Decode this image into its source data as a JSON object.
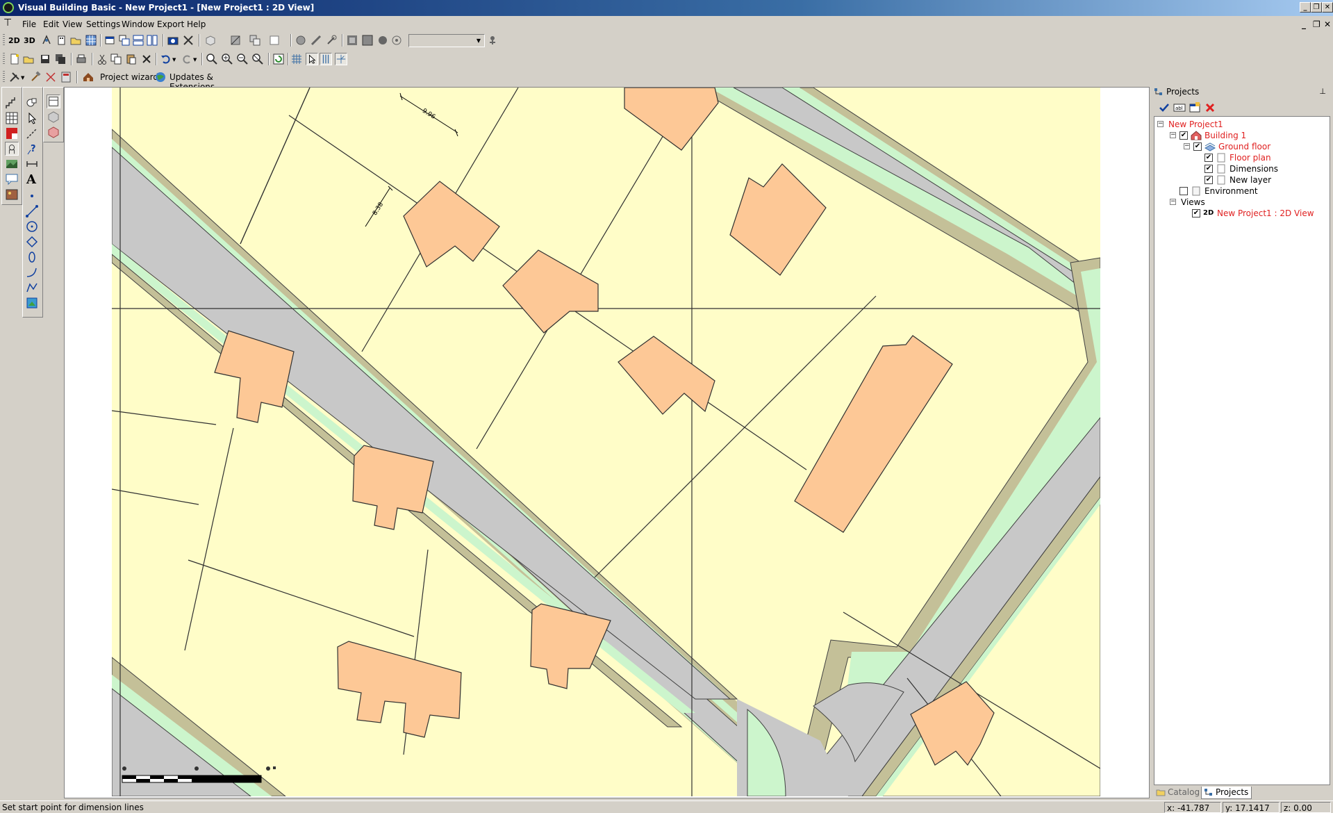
{
  "window": {
    "title": "Visual Building Basic - New Project1 - [New Project1 : 2D View]",
    "controls": [
      "_",
      "❐",
      "✕"
    ]
  },
  "menu": {
    "items": [
      "File",
      "Edit",
      "View",
      "Settings",
      "Window",
      "Export",
      "Help"
    ],
    "mdi_controls": [
      "_",
      "❐",
      "✕"
    ]
  },
  "toolbar3": {
    "project_wizard": "Project wizard",
    "updates": "Updates & Extensions"
  },
  "toolbar1": {
    "labels_2d": "2D",
    "labels_3d": "3D"
  },
  "palette": {
    "text_tool": "A"
  },
  "map": {
    "dimension_1": "9.96 ",
    "dimension_2": "8.38 ",
    "colors": {
      "lot": "#fffdc8",
      "house": "#fdc896",
      "road": "#c8c8c8",
      "verge": "#ccf5cc",
      "curb": "#c4c098",
      "line": "#303030"
    }
  },
  "projects_panel": {
    "title": "Projects",
    "pin": "⊥",
    "tree": [
      {
        "label": "New Project1",
        "color": "red"
      },
      {
        "label": "Building 1",
        "color": "red"
      },
      {
        "label": "Ground floor",
        "color": "red"
      },
      {
        "label": "Floor plan",
        "color": "red"
      },
      {
        "label": "Dimensions",
        "color": "black"
      },
      {
        "label": "New layer",
        "color": "black"
      },
      {
        "label": "Environment",
        "color": "black"
      },
      {
        "label": "Views",
        "color": "black"
      },
      {
        "label": "New Project1 : 2D View",
        "color": "red",
        "badge": "2D"
      }
    ],
    "tabs": [
      "Catalog",
      "Projects"
    ]
  },
  "status": {
    "message": "Set start point for dimension lines",
    "x": "x: -41.787",
    "y": "y: 17.1417",
    "z": "z: 0.00"
  }
}
